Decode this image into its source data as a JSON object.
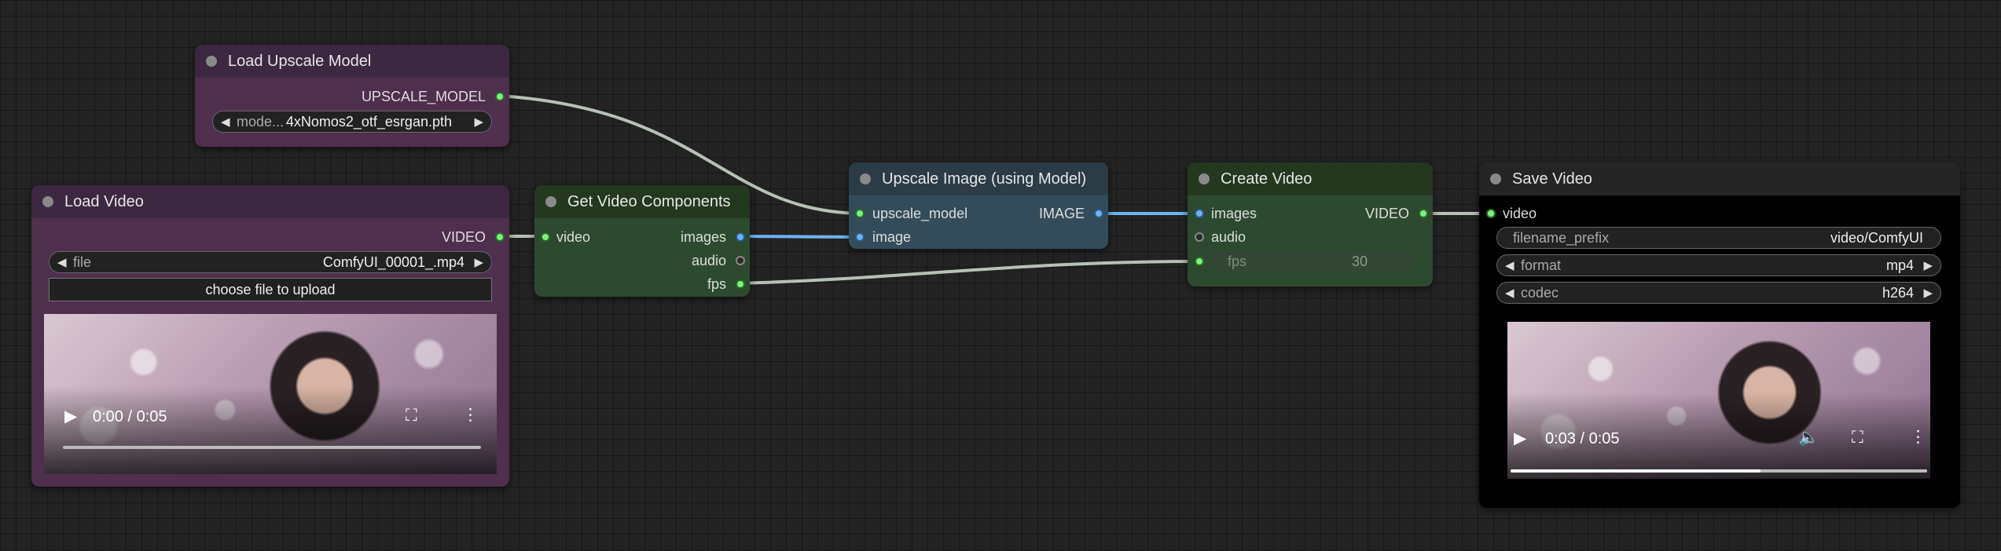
{
  "nodes": {
    "load_upscale_model": {
      "title": "Load Upscale Model",
      "output": "UPSCALE_MODEL",
      "model_label": "mode...",
      "model_value": "4xNomos2_otf_esrgan.pth"
    },
    "load_video": {
      "title": "Load Video",
      "output": "VIDEO",
      "file_label": "file",
      "file_value": "ComfyUI_00001_.mp4",
      "upload_label": "choose file to upload",
      "time": "0:00 / 0:05",
      "progress": 0.0
    },
    "get_video_components": {
      "title": "Get Video Components",
      "input": "video",
      "outputs": [
        "images",
        "audio",
        "fps"
      ]
    },
    "upscale_image": {
      "title": "Upscale Image (using Model)",
      "inputs": [
        "upscale_model",
        "image"
      ],
      "output": "IMAGE"
    },
    "create_video": {
      "title": "Create Video",
      "inputs": [
        "images",
        "audio"
      ],
      "output": "VIDEO",
      "fps_label": "fps",
      "fps_value": "30"
    },
    "save_video": {
      "title": "Save Video",
      "input": "video",
      "filename_label": "filename_prefix",
      "filename_value": "video/ComfyUI",
      "format_label": "format",
      "format_value": "mp4",
      "codec_label": "codec",
      "codec_value": "h264",
      "time": "0:03 / 0:05",
      "progress": 0.6
    }
  },
  "colors": {
    "link_image": "#6cb2f5",
    "link_default": "#b6c2b6",
    "slot_green": "#7cf27c"
  },
  "icons": [
    "play-icon",
    "fullscreen-icon",
    "more-icon",
    "volume-icon",
    "arrow-left-icon",
    "arrow-right-icon"
  ]
}
